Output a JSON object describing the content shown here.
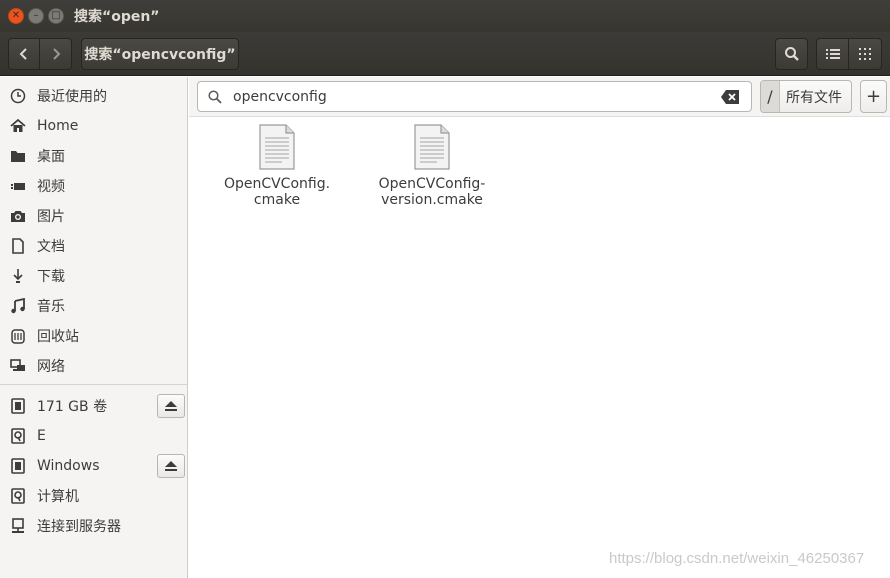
{
  "window": {
    "title": "搜索“open”"
  },
  "header": {
    "path_label": "搜索“opencvconfig”"
  },
  "search": {
    "value": "opencvconfig",
    "location_label": "所有文件",
    "root_label": "/"
  },
  "sidebar": {
    "items": [
      {
        "label": "最近使用的",
        "icon": "clock-icon"
      },
      {
        "label": "Home",
        "icon": "home-icon"
      },
      {
        "label": "桌面",
        "icon": "folder-icon"
      },
      {
        "label": "视频",
        "icon": "video-icon"
      },
      {
        "label": "图片",
        "icon": "camera-icon"
      },
      {
        "label": "文档",
        "icon": "document-icon"
      },
      {
        "label": "下载",
        "icon": "download-icon"
      },
      {
        "label": "音乐",
        "icon": "music-icon"
      },
      {
        "label": "回收站",
        "icon": "trash-icon"
      },
      {
        "label": "网络",
        "icon": "network-icon"
      }
    ],
    "devices": [
      {
        "label": "171 GB 卷",
        "icon": "drive-icon",
        "ejectable": true
      },
      {
        "label": "E",
        "icon": "disk-icon",
        "ejectable": false
      },
      {
        "label": "Windows",
        "icon": "drive-icon",
        "ejectable": true
      },
      {
        "label": "计算机",
        "icon": "disk-icon",
        "ejectable": false
      },
      {
        "label": "连接到服务器",
        "icon": "server-icon",
        "ejectable": false
      }
    ]
  },
  "files": [
    {
      "name": "OpenCVConfig.\ncmake"
    },
    {
      "name": "OpenCVConfig-\nversion.cmake"
    }
  ],
  "watermark": "https://blog.csdn.net/weixin_46250367",
  "colors": {
    "accent_close": "#e95420",
    "header_bg": "#3c3b37",
    "sidebar_bg": "#f5f4f2"
  }
}
